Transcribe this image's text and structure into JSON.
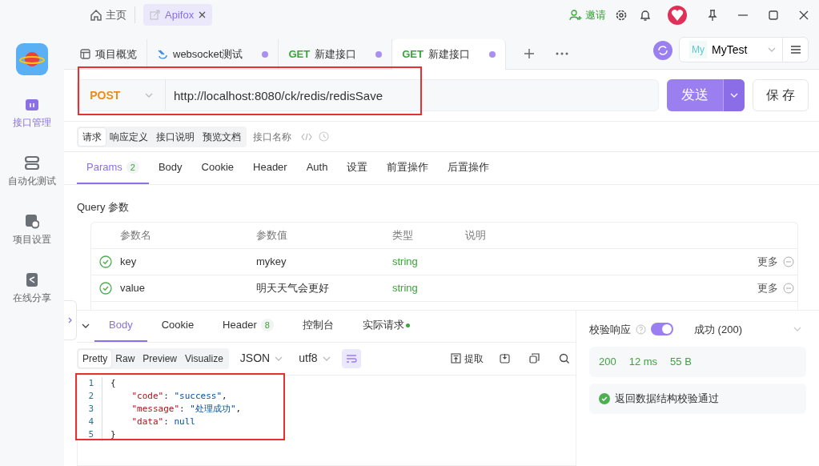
{
  "window": {
    "home_tab": "主页",
    "app_tab": "Apifox",
    "invite": "邀请"
  },
  "sidebar": {
    "items": [
      {
        "kind": "api",
        "label": "接口管理",
        "selected": true
      },
      {
        "kind": "auto",
        "label": "自动化测试",
        "selected": false
      },
      {
        "kind": "settings",
        "label": "项目设置",
        "selected": false
      },
      {
        "kind": "share",
        "label": "在线分享",
        "selected": false
      }
    ]
  },
  "tabs": [
    {
      "kind": "overview",
      "label": "项目概览",
      "unsaved": false,
      "selected": false
    },
    {
      "kind": "websocket",
      "label": "websocket测试",
      "unsaved": true,
      "selected": false
    },
    {
      "kind": "api",
      "method": "GET",
      "label": "新建接口",
      "unsaved": true,
      "selected": false
    },
    {
      "kind": "api",
      "method": "GET",
      "label": "新建接口",
      "unsaved": true,
      "selected": true
    }
  ],
  "environment": {
    "badge": "My",
    "name": "MyTest"
  },
  "request": {
    "method": "POST",
    "url": "http://localhost:8080/ck/redis/redisSave",
    "send": "发送",
    "save": "保 存"
  },
  "view_tabs": [
    {
      "label": "请求",
      "selected": true
    },
    {
      "label": "响应定义",
      "selected": false
    },
    {
      "label": "接口说明",
      "selected": false
    },
    {
      "label": "预览文档",
      "selected": false
    }
  ],
  "name_placeholder": "接口名称",
  "param_tabs": [
    {
      "label": "Params",
      "count": "2",
      "selected": true
    },
    {
      "label": "Body",
      "selected": false
    },
    {
      "label": "Cookie",
      "selected": false
    },
    {
      "label": "Header",
      "selected": false
    },
    {
      "label": "Auth",
      "selected": false
    },
    {
      "label": "设置",
      "selected": false
    },
    {
      "label": "前置操作",
      "selected": false
    },
    {
      "label": "后置操作",
      "selected": false
    }
  ],
  "query": {
    "title": "Query 参数",
    "columns": [
      "参数名",
      "参数值",
      "类型",
      "说明"
    ],
    "rows": [
      {
        "enabled": true,
        "name": "key",
        "value": "mykey",
        "type": "string",
        "more": "更多"
      },
      {
        "enabled": true,
        "name": "value",
        "value": "明天天气会更好",
        "type": "string",
        "more": "更多"
      }
    ]
  },
  "response": {
    "tabs": [
      {
        "label": "Body",
        "selected": true
      },
      {
        "label": "Cookie",
        "selected": false
      },
      {
        "label": "Header",
        "count": "8",
        "selected": false
      },
      {
        "label": "控制台",
        "selected": false
      },
      {
        "label": "实际请求",
        "dot": true,
        "selected": false
      }
    ],
    "formats": [
      {
        "label": "Pretty",
        "selected": true
      },
      {
        "label": "Raw",
        "selected": false
      },
      {
        "label": "Preview",
        "selected": false
      },
      {
        "label": "Visualize",
        "selected": false
      }
    ],
    "language": "JSON",
    "encoding": "utf8",
    "wrap": true,
    "extract": "提取",
    "code": [
      {
        "number": "1",
        "text": "{"
      },
      {
        "number": "2",
        "text": "    \"code\": \"success\","
      },
      {
        "number": "3",
        "text": "    \"message\": \"处理成功\","
      },
      {
        "number": "4",
        "text": "    \"data\": null"
      },
      {
        "number": "5",
        "text": "}"
      }
    ],
    "validate": {
      "label": "校验响应",
      "on": true,
      "result": "成功 (200)"
    },
    "status": "200",
    "time": "12 ms",
    "size": "55 B",
    "check": "返回数据结构校验通过"
  }
}
